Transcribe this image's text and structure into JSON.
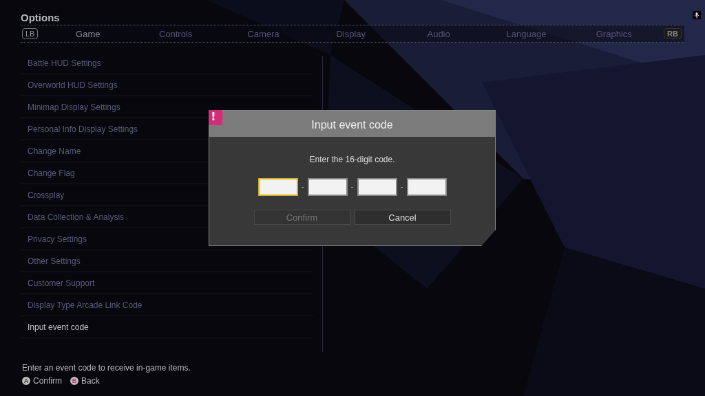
{
  "header": {
    "title": "Options"
  },
  "tabs": {
    "prev_key": "LB",
    "next_key": "RB",
    "items": [
      {
        "label": "Game",
        "selected": true
      },
      {
        "label": "Controls",
        "selected": false
      },
      {
        "label": "Camera",
        "selected": false
      },
      {
        "label": "Display",
        "selected": false
      },
      {
        "label": "Audio",
        "selected": false
      },
      {
        "label": "Language",
        "selected": false
      },
      {
        "label": "Graphics",
        "selected": false
      }
    ]
  },
  "menu": [
    {
      "label": "Battle HUD Settings",
      "selected": false
    },
    {
      "label": "Overworld HUD Settings",
      "selected": false
    },
    {
      "label": "Minimap Display Settings",
      "selected": false
    },
    {
      "label": "Personal Info Display Settings",
      "selected": false
    },
    {
      "label": "Change Name",
      "selected": false
    },
    {
      "label": "Change Flag",
      "selected": false
    },
    {
      "label": "Crossplay",
      "selected": false
    },
    {
      "label": "Data Collection & Analysis",
      "selected": false
    },
    {
      "label": "Privacy Settings",
      "selected": false
    },
    {
      "label": "Other Settings",
      "selected": false
    },
    {
      "label": "Customer Support",
      "selected": false
    },
    {
      "label": "Display Type Arcade Link Code",
      "selected": false
    },
    {
      "label": "Input event code",
      "selected": true
    }
  ],
  "dialog": {
    "badge": "!",
    "title": "Input event code",
    "message": "Enter the 16-digit code.",
    "fields": [
      {
        "selected": true
      },
      {
        "selected": false
      },
      {
        "selected": false
      },
      {
        "selected": false
      }
    ],
    "separators": [
      "-",
      "-",
      "-"
    ],
    "buttons": [
      {
        "label": "Confirm",
        "disabled": true
      },
      {
        "label": "Cancel",
        "disabled": false
      }
    ]
  },
  "footer": {
    "hint": "Enter an event code to receive in-game items.",
    "actions": [
      {
        "key": "A",
        "label": "Confirm",
        "color": "#3a3a3a"
      },
      {
        "key": "B",
        "label": "Back",
        "color": "#d42a78"
      }
    ]
  }
}
